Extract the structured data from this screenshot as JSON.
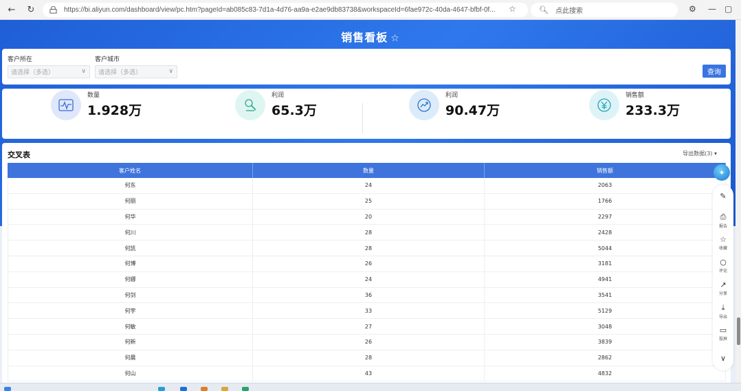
{
  "browser": {
    "url": "https://bi.aliyun.com/dashboard/view/pc.htm?pageId=ab085c83-7d1a-4d76-aa9a-e2ae9db83738&workspaceId=6fae972c-40da-4647-bfbf-0f...",
    "search_placeholder": "点此搜索"
  },
  "dashboard": {
    "title": "销售看板",
    "filters": [
      {
        "label": "客户所在",
        "placeholder": "请选择（多选）"
      },
      {
        "label": "客户城市",
        "placeholder": "请选择（多选）"
      }
    ],
    "query_label": "查询",
    "kpis": [
      {
        "label": "数量",
        "value": "1.928万",
        "icon": "pulse-icon",
        "color": "#dfe7fb"
      },
      {
        "label": "利润",
        "value": "65.3万",
        "icon": "stamp-icon",
        "color": "#dff5f1"
      },
      {
        "label": "利润",
        "value": "90.47万",
        "icon": "trend-icon",
        "color": "#dcebf9"
      },
      {
        "label": "销售额",
        "value": "233.3万",
        "icon": "yuan-icon",
        "color": "#ddf3f7"
      }
    ]
  },
  "table": {
    "title": "交叉表",
    "dropdown_label": "导出数据(3)",
    "columns": [
      "客户姓名",
      "数量",
      "销售额"
    ],
    "rows": [
      [
        "何东",
        "24",
        "2063"
      ],
      [
        "何丽",
        "25",
        "1766"
      ],
      [
        "何华",
        "20",
        "2297"
      ],
      [
        "何川",
        "28",
        "2428"
      ],
      [
        "何凯",
        "28",
        "5044"
      ],
      [
        "何博",
        "26",
        "3181"
      ],
      [
        "何娜",
        "24",
        "4941"
      ],
      [
        "何剑",
        "36",
        "3541"
      ],
      [
        "何宇",
        "33",
        "5129"
      ],
      [
        "何敏",
        "27",
        "3048"
      ],
      [
        "何新",
        "26",
        "3839"
      ],
      [
        "何晨",
        "28",
        "2862"
      ],
      [
        "何山",
        "43",
        "4832"
      ]
    ]
  },
  "side_tools": [
    {
      "icon": "edit-icon",
      "label": ""
    },
    {
      "icon": "report-icon",
      "label": "报告"
    },
    {
      "icon": "star-icon",
      "label": "收藏"
    },
    {
      "icon": "comment-icon",
      "label": "评论"
    },
    {
      "icon": "share-icon",
      "label": "分享"
    },
    {
      "icon": "download-icon",
      "label": "导出"
    },
    {
      "icon": "present-icon",
      "label": "投屏"
    },
    {
      "icon": "chevron-down-icon",
      "label": ""
    }
  ],
  "colors": {
    "brand_blue": "#2f78ec",
    "table_header": "#3e74dc"
  }
}
